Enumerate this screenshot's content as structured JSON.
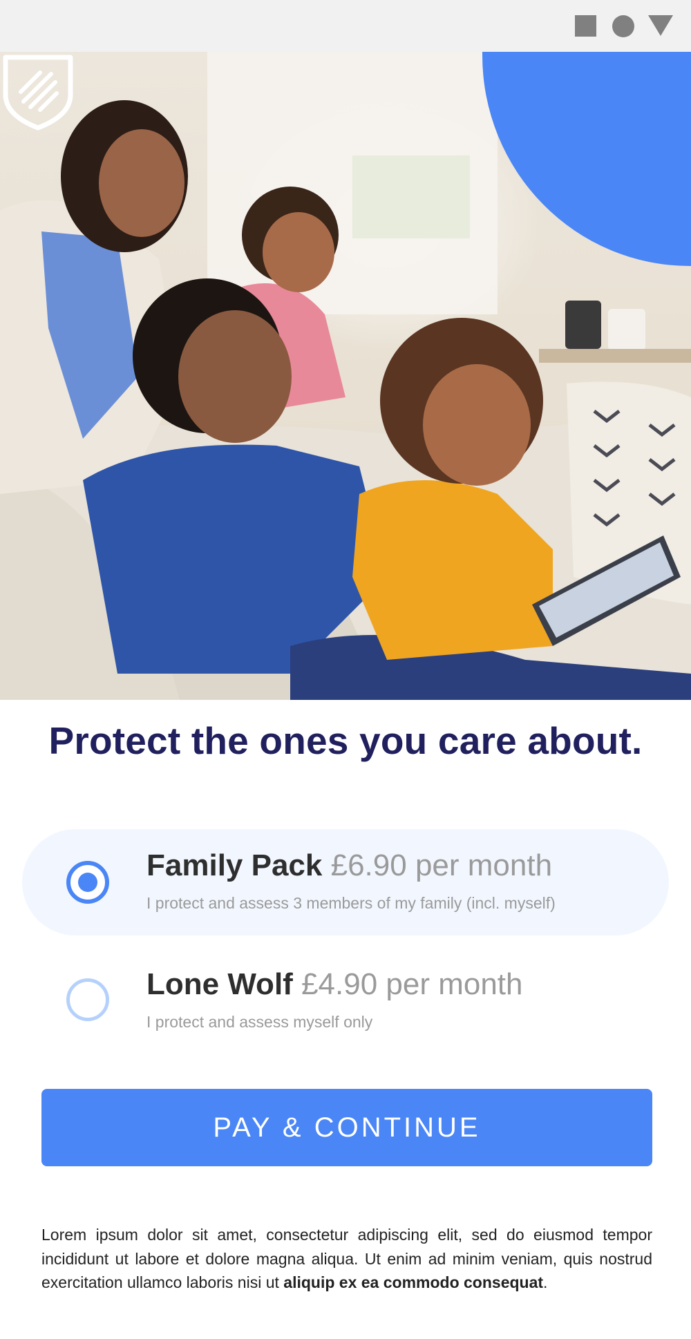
{
  "status_bar": {
    "icons": [
      "square-icon",
      "circle-icon",
      "triangle-icon"
    ]
  },
  "hero": {
    "brand_icon": "shield-logo-icon",
    "accent_color": "#4a86f5"
  },
  "headline": "Protect the ones you care about.",
  "plans": [
    {
      "name": "Family Pack",
      "price": "£6.90 per month",
      "description": "I protect and assess 3 members of my family (incl. myself)",
      "selected": true
    },
    {
      "name": "Lone Wolf",
      "price": "£4.90 per month",
      "description": "I protect and assess myself only",
      "selected": false
    }
  ],
  "cta": {
    "label": "PAY & CONTINUE",
    "color": "#4a86f5"
  },
  "legal": {
    "text": "Lorem ipsum dolor sit amet, consectetur adipiscing elit, sed do eiusmod tempor incididunt ut labore et dolore magna aliqua. Ut enim ad minim veniam, quis nostrud exercitation ullamco laboris nisi ut",
    "bold": "aliquip ex ea commodo consequat",
    "end": "."
  },
  "colors": {
    "headline": "#21205e",
    "selected_plan_bg": "#f2f7ff",
    "radio_off": "#b5d1fb"
  }
}
